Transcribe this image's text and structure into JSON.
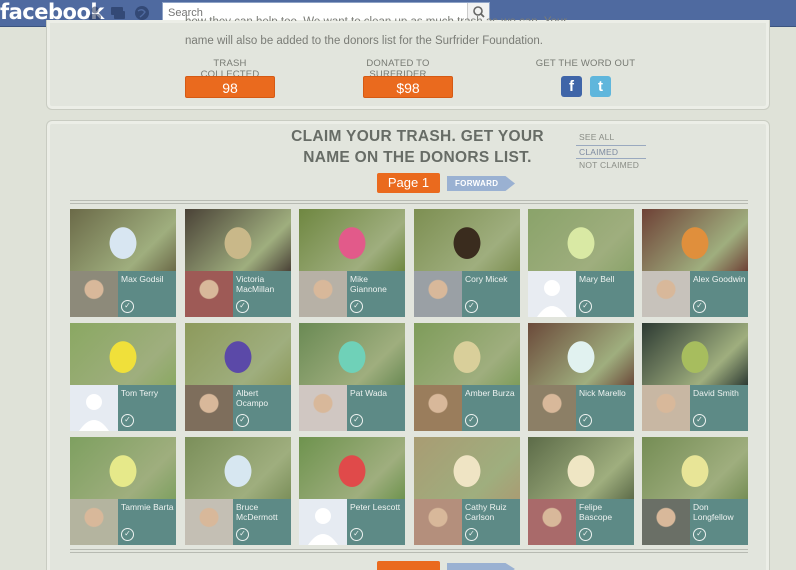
{
  "facebook": {
    "logo": "facebook",
    "search_placeholder": "Search",
    "icons": [
      "friends-icon",
      "messages-icon",
      "notifications-globe-icon"
    ]
  },
  "intro": {
    "line1": "how they can help too. We want to clean up as much trash as we can. Your",
    "line2": "name will also be added to the donors list for the Surfrider Foundation."
  },
  "stats": {
    "trash_label": "TRASH COLLECTED",
    "trash_value": "98",
    "donated_label": "DONATED TO SURFRIDER",
    "donated_value": "$98",
    "share_label": "GET THE WORD OUT"
  },
  "colors": {
    "accent": "#ea6a1e",
    "facebook_blue": "#4f6aa0",
    "tile_teal": "#5d8a86",
    "forward_blue": "#9ab1d2"
  },
  "claim": {
    "title_line1": "CLAIM YOUR TRASH. GET YOUR",
    "title_line2": "NAME ON THE DONORS LIST."
  },
  "filters": [
    {
      "label": "SEE ALL",
      "active": false
    },
    {
      "label": "CLAIMED",
      "active": true
    },
    {
      "label": "NOT CLAIMED",
      "active": false
    }
  ],
  "pager": {
    "page_label": "Page 1",
    "forward_label": "FORWARD"
  },
  "tiles": [
    {
      "name": "Max Godsil"
    },
    {
      "name": "Victoria MacMillan"
    },
    {
      "name": "Mike Giannone"
    },
    {
      "name": "Cory Micek"
    },
    {
      "name": "Mary Bell"
    },
    {
      "name": "Alex Goodwin"
    },
    {
      "name": "Tom Terry"
    },
    {
      "name": "Albert Ocampo"
    },
    {
      "name": "Pat Wada"
    },
    {
      "name": "Amber Burza"
    },
    {
      "name": "Nick Marello"
    },
    {
      "name": "David Smith"
    },
    {
      "name": "Tammie Barta"
    },
    {
      "name": "Bruce McDermott"
    },
    {
      "name": "Peter Lescott"
    },
    {
      "name": "Cathy Ruiz Carlson"
    },
    {
      "name": "Felipe Bascope"
    },
    {
      "name": "Don Longfellow"
    }
  ]
}
